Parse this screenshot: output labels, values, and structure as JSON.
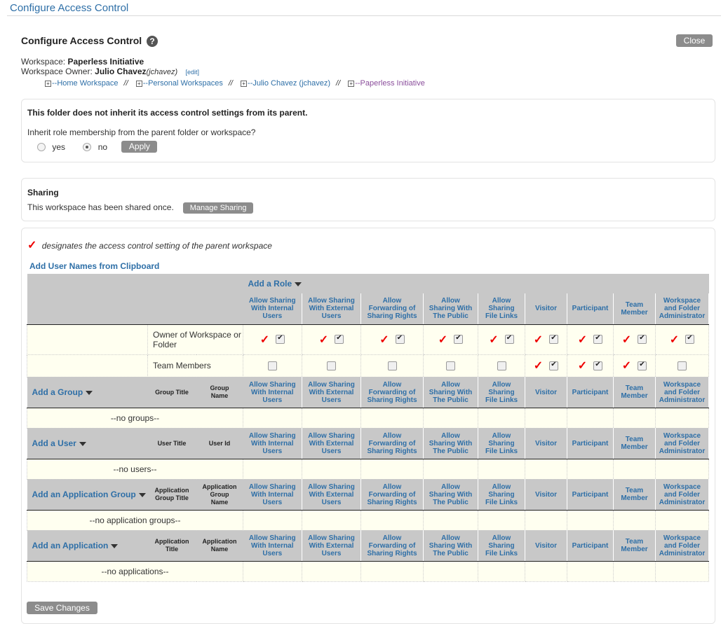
{
  "window": {
    "title": "Configure Access Control"
  },
  "dialog": {
    "title": "Configure Access Control",
    "help": "?",
    "close_label": "Close",
    "workspace_label": "Workspace:",
    "workspace_name": "Paperless Initiative",
    "owner_label": "Workspace Owner:",
    "owner_name": "Julio Chavez",
    "owner_id": "(jchavez)",
    "edit_label": "[edit]"
  },
  "breadcrumb": [
    {
      "label": "Home Workspace",
      "sep": "//"
    },
    {
      "label": "Personal Workspaces",
      "sep": "//"
    },
    {
      "label": "Julio Chavez (jchavez)",
      "sep": "//"
    },
    {
      "label": "Paperless Initiative",
      "sep": ""
    }
  ],
  "inherit": {
    "message": "This folder does not inherit its access control settings from its parent.",
    "question": "Inherit role membership from the parent folder or workspace?",
    "yes_label": "yes",
    "no_label": "no",
    "selected": "no",
    "apply_label": "Apply"
  },
  "sharing": {
    "heading": "Sharing",
    "text": "This workspace has been shared once.",
    "manage_label": "Manage Sharing"
  },
  "main": {
    "legend": "designates the access control setting of the parent workspace",
    "check_glyph": "✓",
    "clipboard_link": "Add User Names from Clipboard",
    "save_label": "Save Changes"
  },
  "columns": [
    [
      "Allow Sharing",
      "With Internal",
      "Users"
    ],
    [
      "Allow Sharing",
      "With External",
      "Users"
    ],
    [
      "Allow",
      "Forwarding of",
      "Sharing Rights"
    ],
    [
      "Allow",
      "Sharing With",
      "The Public"
    ],
    [
      "Allow",
      "Sharing",
      "File Links"
    ],
    [
      "Visitor"
    ],
    [
      "Participant"
    ],
    [
      "Team",
      "Member"
    ],
    [
      "Workspace",
      "and Folder",
      "Administrator"
    ]
  ],
  "roles": {
    "add_label": "Add a Role",
    "rows": [
      {
        "name": "Owner of Workspace or Folder",
        "parent": [
          true,
          true,
          true,
          true,
          true,
          true,
          true,
          true,
          true
        ],
        "checked": [
          true,
          true,
          true,
          true,
          true,
          true,
          true,
          true,
          true
        ]
      },
      {
        "name": "Team Members",
        "parent": [
          false,
          false,
          false,
          false,
          false,
          true,
          true,
          true,
          false
        ],
        "checked": [
          false,
          false,
          false,
          false,
          false,
          true,
          true,
          true,
          false
        ]
      }
    ]
  },
  "groups": {
    "add_label": "Add a Group",
    "col1": [
      "Group Title"
    ],
    "col2": [
      "Group",
      "Name"
    ],
    "empty": "--no groups--"
  },
  "users": {
    "add_label": "Add a User",
    "col1": [
      "User Title"
    ],
    "col2": [
      "User Id"
    ],
    "empty": "--no users--"
  },
  "app_groups": {
    "add_label": "Add an Application Group",
    "col1": [
      "Application",
      "Group Title"
    ],
    "col2": [
      "Application",
      "Group",
      "Name"
    ],
    "empty": "--no application groups--"
  },
  "apps": {
    "add_label": "Add an Application",
    "col1": [
      "Application",
      "Title"
    ],
    "col2": [
      "Application",
      "Name"
    ],
    "empty": "--no applications--"
  }
}
